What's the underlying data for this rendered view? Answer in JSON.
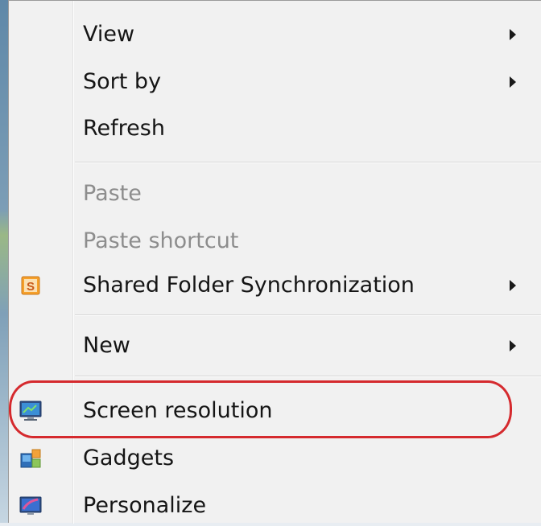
{
  "context_menu": {
    "items": [
      {
        "label": "View",
        "has_submenu": true,
        "enabled": true
      },
      {
        "label": "Sort by",
        "has_submenu": true,
        "enabled": true
      },
      {
        "label": "Refresh",
        "has_submenu": false,
        "enabled": true
      },
      {
        "label": "Paste",
        "has_submenu": false,
        "enabled": false
      },
      {
        "label": "Paste shortcut",
        "has_submenu": false,
        "enabled": false
      },
      {
        "label": "Shared Folder Synchronization",
        "has_submenu": true,
        "enabled": true,
        "icon": "shared-folder-sync-icon"
      },
      {
        "label": "New",
        "has_submenu": true,
        "enabled": true
      },
      {
        "label": "Screen resolution",
        "has_submenu": false,
        "enabled": true,
        "icon": "monitor-icon",
        "highlighted": true
      },
      {
        "label": "Gadgets",
        "has_submenu": false,
        "enabled": true,
        "icon": "gadgets-icon"
      },
      {
        "label": "Personalize",
        "has_submenu": false,
        "enabled": true,
        "icon": "personalize-icon"
      }
    ],
    "shared_folder_icon_letter": "S"
  },
  "colors": {
    "menu_background": "#f1f1f1",
    "disabled_text": "#8d8d8d",
    "highlight_ring": "#d52a2e"
  }
}
